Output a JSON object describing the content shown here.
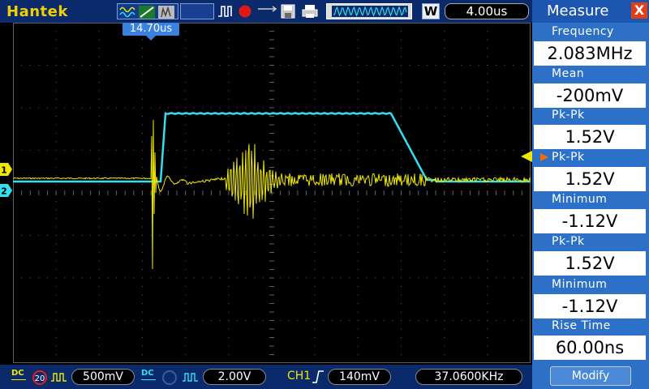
{
  "topbar": {
    "brand": "Hantek",
    "timebase": "4.00us",
    "w_label": "W",
    "icons": [
      "waveform-type-icon",
      "trigger-slope-icon",
      "persist-icon",
      "pulse-icon",
      "record-icon",
      "save-icon",
      "print-icon",
      "waveform-window-icon"
    ]
  },
  "scope": {
    "trigger_position_label": "14.70us",
    "ch1_marker": "1",
    "ch2_marker": "2",
    "colors": {
      "ch1": "#f0e800",
      "ch2": "#2ee0f0",
      "grid": "#606060"
    }
  },
  "bottombar": {
    "ch1_coupling": "DC",
    "ch1_bw_limit": "20",
    "ch1_scale": "500mV",
    "ch2_coupling": "DC",
    "ch2_scale": "2.00V",
    "trigger_source": "CH1",
    "trigger_level": "140mV",
    "trigger_frequency": "37.0600KHz"
  },
  "measure": {
    "title": "Measure",
    "close_label": "X",
    "items": [
      {
        "label": "Frequency",
        "value": "2.083MHz"
      },
      {
        "label": "Mean",
        "value": "-200mV"
      },
      {
        "label": "Pk-Pk",
        "value": "1.52V"
      },
      {
        "label": "Pk-Pk",
        "value": "1.52V"
      },
      {
        "label": "Minimum",
        "value": "-1.12V"
      },
      {
        "label": "Pk-Pk",
        "value": "1.52V"
      },
      {
        "label": "Minimum",
        "value": "-1.12V"
      },
      {
        "label": "Rise Time",
        "value": "60.00ns"
      }
    ],
    "modify_label": "Modify"
  }
}
